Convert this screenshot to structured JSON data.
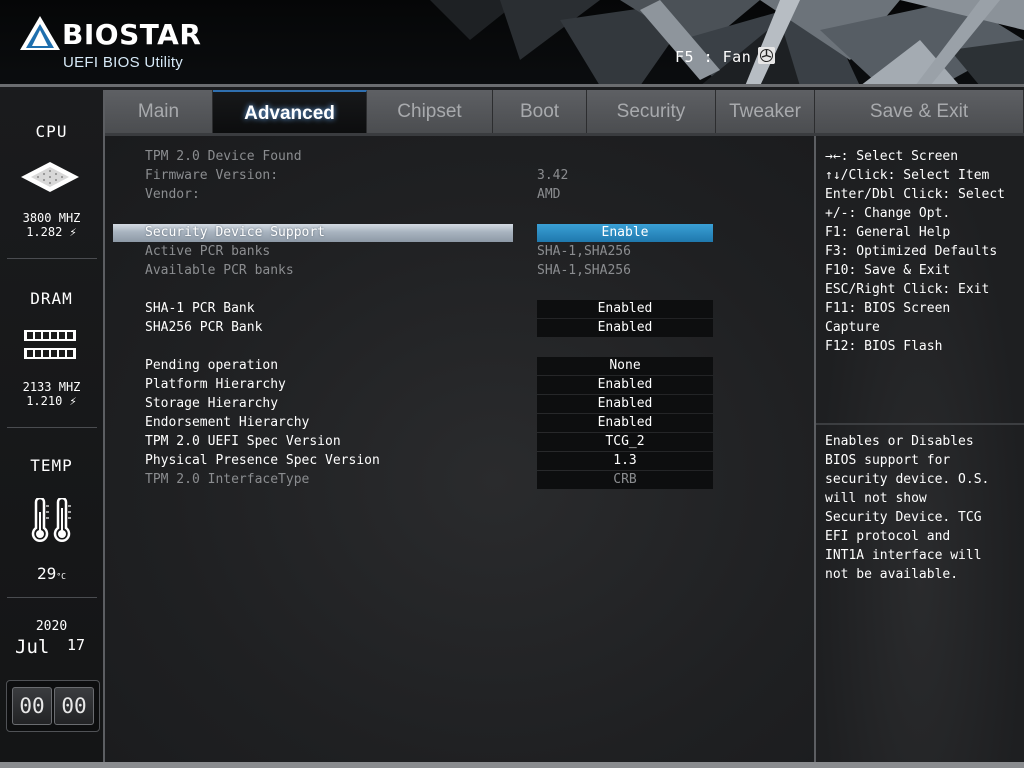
{
  "header": {
    "brand": "BIOSTAR",
    "subtitle": "UEFI BIOS Utility",
    "fan_hint": "F5 : Fan"
  },
  "sidebar": {
    "cpu": {
      "label": "CPU",
      "freq": "3800 MHZ",
      "volt": "1.282"
    },
    "dram": {
      "label": "DRAM",
      "freq": "2133 MHZ",
      "volt": "1.210"
    },
    "temp": {
      "label": "TEMP",
      "value": "29",
      "unit": "°C"
    },
    "date": {
      "year": "2020",
      "month": "Jul",
      "day": "17"
    },
    "clock": {
      "hours": "00",
      "minutes": "00"
    }
  },
  "tabs": [
    "Main",
    "Advanced",
    "Chipset",
    "Boot",
    "Security",
    "Tweaker",
    "Save & Exit"
  ],
  "active_tab": "Advanced",
  "main": {
    "info": [
      {
        "label": "TPM 2.0 Device Found",
        "value": ""
      },
      {
        "label": "Firmware Version:",
        "value": "3.42"
      },
      {
        "label": "Vendor:",
        "value": "AMD"
      }
    ],
    "security_device_support": {
      "label": "Security Device Support",
      "value": "Enable"
    },
    "active_pcr": {
      "label": "Active PCR banks",
      "value": "SHA-1,SHA256"
    },
    "available_pcr": {
      "label": "Available PCR banks",
      "value": "SHA-1,SHA256"
    },
    "sha1_bank": {
      "label": "SHA-1 PCR Bank",
      "value": "Enabled"
    },
    "sha256_bank": {
      "label": "SHA256 PCR Bank",
      "value": "Enabled"
    },
    "pending_operation": {
      "label": "Pending operation",
      "value": "None"
    },
    "platform_hierarchy": {
      "label": "Platform Hierarchy",
      "value": "Enabled"
    },
    "storage_hierarchy": {
      "label": "Storage Hierarchy",
      "value": "Enabled"
    },
    "endorsement_hierarchy": {
      "label": "Endorsement Hierarchy",
      "value": "Enabled"
    },
    "uefi_spec_version": {
      "label": "TPM 2.0 UEFI Spec Version",
      "value": "TCG_2"
    },
    "physical_presence": {
      "label": "Physical Presence Spec Version",
      "value": "1.3"
    },
    "interface_type": {
      "label": "TPM 2.0 InterfaceType",
      "value": "CRB"
    }
  },
  "help": {
    "keys": [
      "→←: Select Screen",
      "↑↓/Click: Select Item",
      "Enter/Dbl Click: Select",
      "+/-: Change Opt.",
      "F1: General Help",
      "F3: Optimized Defaults",
      "F10: Save & Exit",
      "ESC/Right Click: Exit",
      "F11: BIOS Screen",
      "Capture",
      "F12: BIOS Flash"
    ],
    "description": [
      "Enables or Disables",
      "BIOS support for",
      "security device. O.S.",
      "will not show",
      "Security Device. TCG",
      "EFI protocol and",
      "INT1A interface will",
      "not be available."
    ]
  },
  "colors": {
    "accent_blue": "#2a8ec6",
    "selected_row": "#a8b3bf",
    "disabled_text": "#8b8d90"
  }
}
